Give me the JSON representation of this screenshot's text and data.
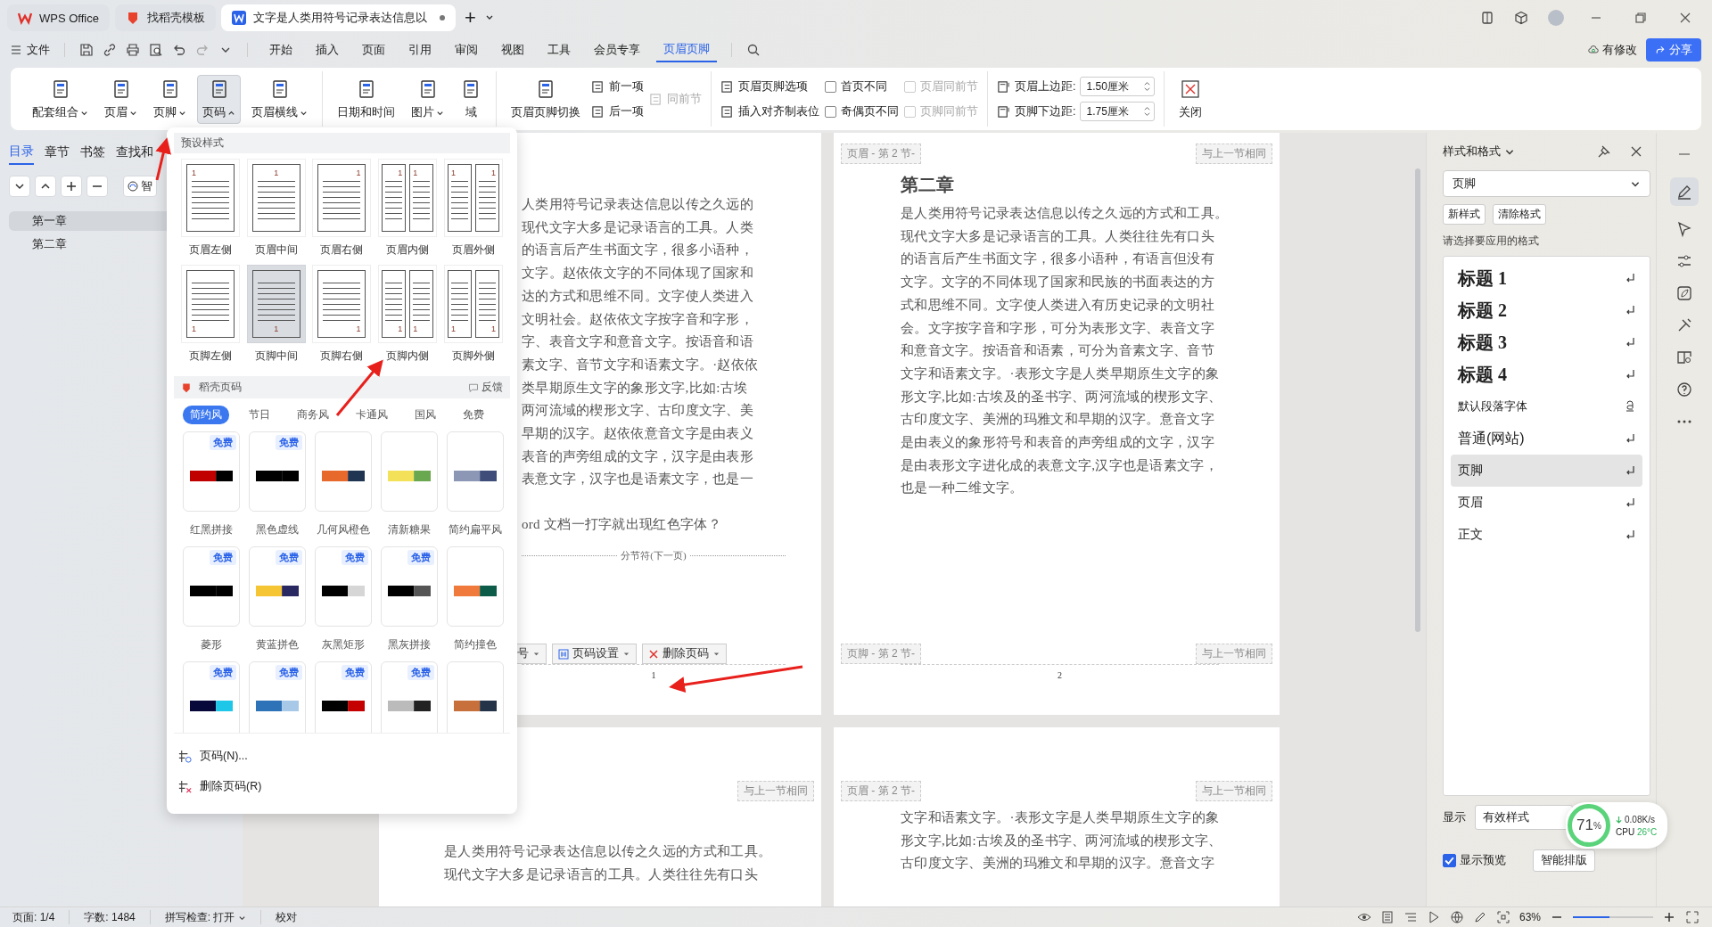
{
  "title_bar": {
    "tabs": [
      {
        "label": "WPS Office",
        "kind": "home",
        "selected": false
      },
      {
        "label": "找稻壳模板",
        "kind": "template",
        "selected": false
      },
      {
        "label": "文字是人类用符号记录表达信息以",
        "kind": "doc",
        "selected": true,
        "unsaved": true
      }
    ],
    "new_tab": "+"
  },
  "menu_bar": {
    "file": "文件",
    "tabs": [
      {
        "label": "开始",
        "selected": false
      },
      {
        "label": "插入",
        "selected": false
      },
      {
        "label": "页面",
        "selected": false
      },
      {
        "label": "引用",
        "selected": false
      },
      {
        "label": "审阅",
        "selected": false
      },
      {
        "label": "视图",
        "selected": false
      },
      {
        "label": "工具",
        "selected": false
      },
      {
        "label": "会员专享",
        "selected": false
      },
      {
        "label": "页眉页脚",
        "selected": true
      }
    ],
    "modified": "有修改",
    "share": "分享"
  },
  "ribbon": {
    "groups": [
      {
        "columns": [
          {
            "kind": "big",
            "label": "配套组合",
            "dropdown": true,
            "expanded": false
          },
          {
            "kind": "big",
            "label": "页眉",
            "dropdown": true,
            "expanded": false
          },
          {
            "kind": "big",
            "label": "页脚",
            "dropdown": true,
            "expanded": false
          },
          {
            "kind": "big",
            "label": "页码",
            "dropdown": true,
            "expanded": true
          },
          {
            "kind": "big",
            "label": "页眉横线",
            "dropdown": true,
            "expanded": false
          }
        ]
      },
      {
        "columns": [
          {
            "kind": "big",
            "label": "日期和时间"
          },
          {
            "kind": "big",
            "label": "图片",
            "dropdown": true,
            "expanded": false
          },
          {
            "kind": "big",
            "label": "域"
          }
        ]
      },
      {
        "columns": [
          {
            "kind": "big",
            "label": "页眉页脚切换"
          },
          {
            "kind": "stack",
            "items": [
              {
                "kind": "small",
                "label": "前一项",
                "disabled": false
              },
              {
                "kind": "small",
                "label": "后一项",
                "disabled": false
              }
            ]
          },
          {
            "kind": "stack",
            "items": [
              {
                "kind": "small",
                "label": "同前节",
                "disabled": true
              }
            ]
          }
        ]
      },
      {
        "columns": [
          {
            "kind": "stack",
            "items": [
              {
                "kind": "small",
                "label": "页眉页脚选项",
                "disabled": false
              },
              {
                "kind": "small",
                "label": "插入对齐制表位",
                "disabled": false
              }
            ]
          },
          {
            "kind": "stack",
            "items": [
              {
                "kind": "check",
                "label": "首页不同",
                "checked": false,
                "disabled": false
              },
              {
                "kind": "check",
                "label": "奇偶页不同",
                "checked": false,
                "disabled": false
              }
            ]
          },
          {
            "kind": "stack",
            "items": [
              {
                "kind": "check",
                "label": "页眉同前节",
                "checked": false,
                "disabled": true
              },
              {
                "kind": "check",
                "label": "页脚同前节",
                "checked": false,
                "disabled": true
              }
            ]
          }
        ]
      },
      {
        "columns": [
          {
            "kind": "stack",
            "items": [
              {
                "kind": "spin",
                "label": "页眉上边距:",
                "value": "1.50厘米"
              },
              {
                "kind": "spin",
                "label": "页脚下边距:",
                "value": "1.75厘米"
              }
            ]
          }
        ]
      },
      {
        "columns": [
          {
            "kind": "close",
            "label": "关闭"
          }
        ]
      }
    ]
  },
  "left_nav": {
    "tabs": [
      {
        "label": "目录",
        "selected": true
      },
      {
        "label": "章节",
        "selected": false
      },
      {
        "label": "书签",
        "selected": false
      },
      {
        "label": "查找和",
        "selected": false
      }
    ],
    "smart": "智",
    "outline": [
      {
        "label": "第一章",
        "selected": true
      },
      {
        "label": "第二章",
        "selected": false
      }
    ]
  },
  "page_number_menu": {
    "preset_title": "预设样式",
    "presets": [
      {
        "label": "页眉左侧",
        "kind": "header-left",
        "numbers": [
          "1"
        ],
        "selected": false
      },
      {
        "label": "页眉中间",
        "kind": "header-center",
        "numbers": [
          "1"
        ],
        "selected": false
      },
      {
        "label": "页眉右侧",
        "kind": "header-right",
        "numbers": [
          "1"
        ],
        "selected": false
      },
      {
        "label": "页眉内侧",
        "kind": "header-inside",
        "numbers": [
          "1",
          "1"
        ],
        "selected": false
      },
      {
        "label": "页眉外侧",
        "kind": "header-outside",
        "numbers": [
          "1",
          "1"
        ],
        "selected": false
      },
      {
        "label": "页脚左侧",
        "kind": "footer-left",
        "numbers": [
          "1"
        ],
        "selected": false
      },
      {
        "label": "页脚中间",
        "kind": "footer-center",
        "numbers": [
          "1"
        ],
        "selected": true
      },
      {
        "label": "页脚右侧",
        "kind": "footer-right",
        "numbers": [
          "1"
        ],
        "selected": false
      },
      {
        "label": "页脚内侧",
        "kind": "footer-inside",
        "numbers": [
          "1",
          "1"
        ],
        "selected": false
      },
      {
        "label": "页脚外侧",
        "kind": "footer-outside",
        "numbers": [
          "1",
          "1"
        ],
        "selected": false
      }
    ],
    "daoke_title": "稻壳页码",
    "feedback": "反馈",
    "categories": [
      {
        "label": "简约风",
        "selected": true
      },
      {
        "label": "节日",
        "selected": false
      },
      {
        "label": "商务风",
        "selected": false
      },
      {
        "label": "卡通风",
        "selected": false
      },
      {
        "label": "国风",
        "selected": false
      },
      {
        "label": "免费",
        "selected": false
      }
    ],
    "templates": [
      {
        "name": "红黑拼接",
        "free": true,
        "badge": "免费"
      },
      {
        "name": "黑色虚线",
        "free": true,
        "badge": "免费"
      },
      {
        "name": "几何风橙色",
        "free": false
      },
      {
        "name": "清新糖果",
        "free": false
      },
      {
        "name": "简约扁平风",
        "free": false
      },
      {
        "name": "菱形",
        "free": true,
        "badge": "免费"
      },
      {
        "name": "黄蓝拼色",
        "free": true,
        "badge": "免费"
      },
      {
        "name": "灰黑矩形",
        "free": true,
        "badge": "免费"
      },
      {
        "name": "黑灰拼接",
        "free": true,
        "badge": "免费"
      },
      {
        "name": "简约撞色",
        "free": false
      },
      {
        "free": true,
        "badge": "免费"
      },
      {
        "free": true,
        "badge": "免费"
      },
      {
        "free": true,
        "badge": "免费"
      },
      {
        "free": true,
        "badge": "免费"
      },
      {
        "free": false
      }
    ],
    "actions": [
      {
        "label": "页码(N)...",
        "kind": "insert"
      },
      {
        "label": "删除页码(R)",
        "kind": "delete"
      }
    ]
  },
  "document": {
    "pages": [
      {
        "lines": [
          "人类用符号记录表达信息以传之久远的",
          "现代文字大多是记录语言的工具。人类",
          "的语言后产生书面文字，很多小语种，",
          "文字。赵依依文字的不同体现了国家和",
          "达的方式和思维不同。文字使人类进入",
          "文明社会。赵依依文字按字音和字形，",
          "字、表音文字和意音文字。按语音和语",
          "素文字、音节文字和语素文字。·赵依依",
          "类早期原生文字的象形文字,比如:古埃",
          "两河流域的楔形文字、古印度文字、美",
          "早期的汉字。赵依依意音文字是由表义",
          "表音的声旁组成的文字，汉字是由表形",
          "表意文字，汉字也是语素文字，也是一"
        ],
        "extra_line": "ord 文档一打字就出现红色字体？",
        "section_break": "分节符(下一页)",
        "footer_tools": [
          {
            "label": "号",
            "kind": "numbering"
          },
          {
            "label": "页码设置",
            "kind": "settings"
          },
          {
            "label": "删除页码",
            "kind": "delete"
          }
        ],
        "page_number": "1"
      },
      {
        "header_tag": "页眉 - 第 2 节-",
        "header_same": "与上一节相同",
        "heading": "第二章",
        "lines": [
          "是人类用符号记录表达信息以传之久远的方式和工具。",
          "现代文字大多是记录语言的工具。人类往往先有口头",
          "的语言后产生书面文字，很多小语种，有语言但没有",
          "文字。文字的不同体现了国家和民族的书面表达的方",
          "式和思维不同。文字使人类进入有历史记录的文明社",
          "会。文字按字音和字形，可分为表形文字、表音文字",
          "和意音文字。按语音和语素，可分为音素文字、音节",
          "文字和语素文字。·表形文字是人类早期原生文字的象",
          "形文字,比如:古埃及的圣书字、两河流域的楔形文字、",
          "古印度文字、美洲的玛雅文和早期的汉字。意音文字",
          "是由表义的象形符号和表音的声旁组成的文字，汉字",
          "是由表形文字进化成的表意文字,汉字也是语素文字，",
          "也是一种二维文字。"
        ],
        "footer_tag": "页脚 - 第 2 节-",
        "footer_same": "与上一节相同",
        "page_number": "2"
      },
      {
        "header_same": "与上一节相同",
        "lines": [
          "是人类用符号记录表达信息以传之久远的方式和工具。",
          "现代文字大多是记录语言的工具。人类往往先有口头"
        ]
      },
      {
        "header_tag": "页眉 - 第 2 节-",
        "header_same": "与上一节相同",
        "lines": [
          "文字和语素文字。·表形文字是人类早期原生文字的象",
          "形文字,比如:古埃及的圣书字、两河流域的楔形文字、",
          "古印度文字、美洲的玛雅文和早期的汉字。意音文字"
        ]
      }
    ]
  },
  "styles_panel": {
    "title": "样式和格式",
    "current": "页脚",
    "buttons": [
      "新样式",
      "清除格式"
    ],
    "prompt": "请选择要应用的格式",
    "styles": [
      {
        "label": "标题 1",
        "kind": "heading",
        "selected": false
      },
      {
        "label": "标题 2",
        "kind": "heading",
        "selected": false
      },
      {
        "label": "标题 3",
        "kind": "heading",
        "selected": false
      },
      {
        "label": "标题 4",
        "kind": "heading",
        "selected": false
      },
      {
        "label": "默认段落字体",
        "kind": "character",
        "selected": false
      },
      {
        "label": "普通(网站)",
        "kind": "web",
        "selected": false
      },
      {
        "label": "页脚",
        "kind": "plain",
        "selected": true
      },
      {
        "label": "页眉",
        "kind": "plain",
        "selected": false
      },
      {
        "label": "正文",
        "kind": "plain",
        "selected": false
      }
    ],
    "show_label": "显示",
    "show_value": "有效样式",
    "preview": {
      "label": "显示预览",
      "checked": true
    },
    "smart": "智能排版"
  },
  "monitor": {
    "percent": "71",
    "unit": "%",
    "speed": "0.08K/s",
    "cpu": "CPU",
    "temp": "26°C"
  },
  "status_bar": {
    "page": "页面: 1/4",
    "words": "字数: 1484",
    "spell": "拼写检查: 打开",
    "proof": "校对",
    "zoom": "63%",
    "zoom_slider": {
      "level": 0.45
    }
  }
}
